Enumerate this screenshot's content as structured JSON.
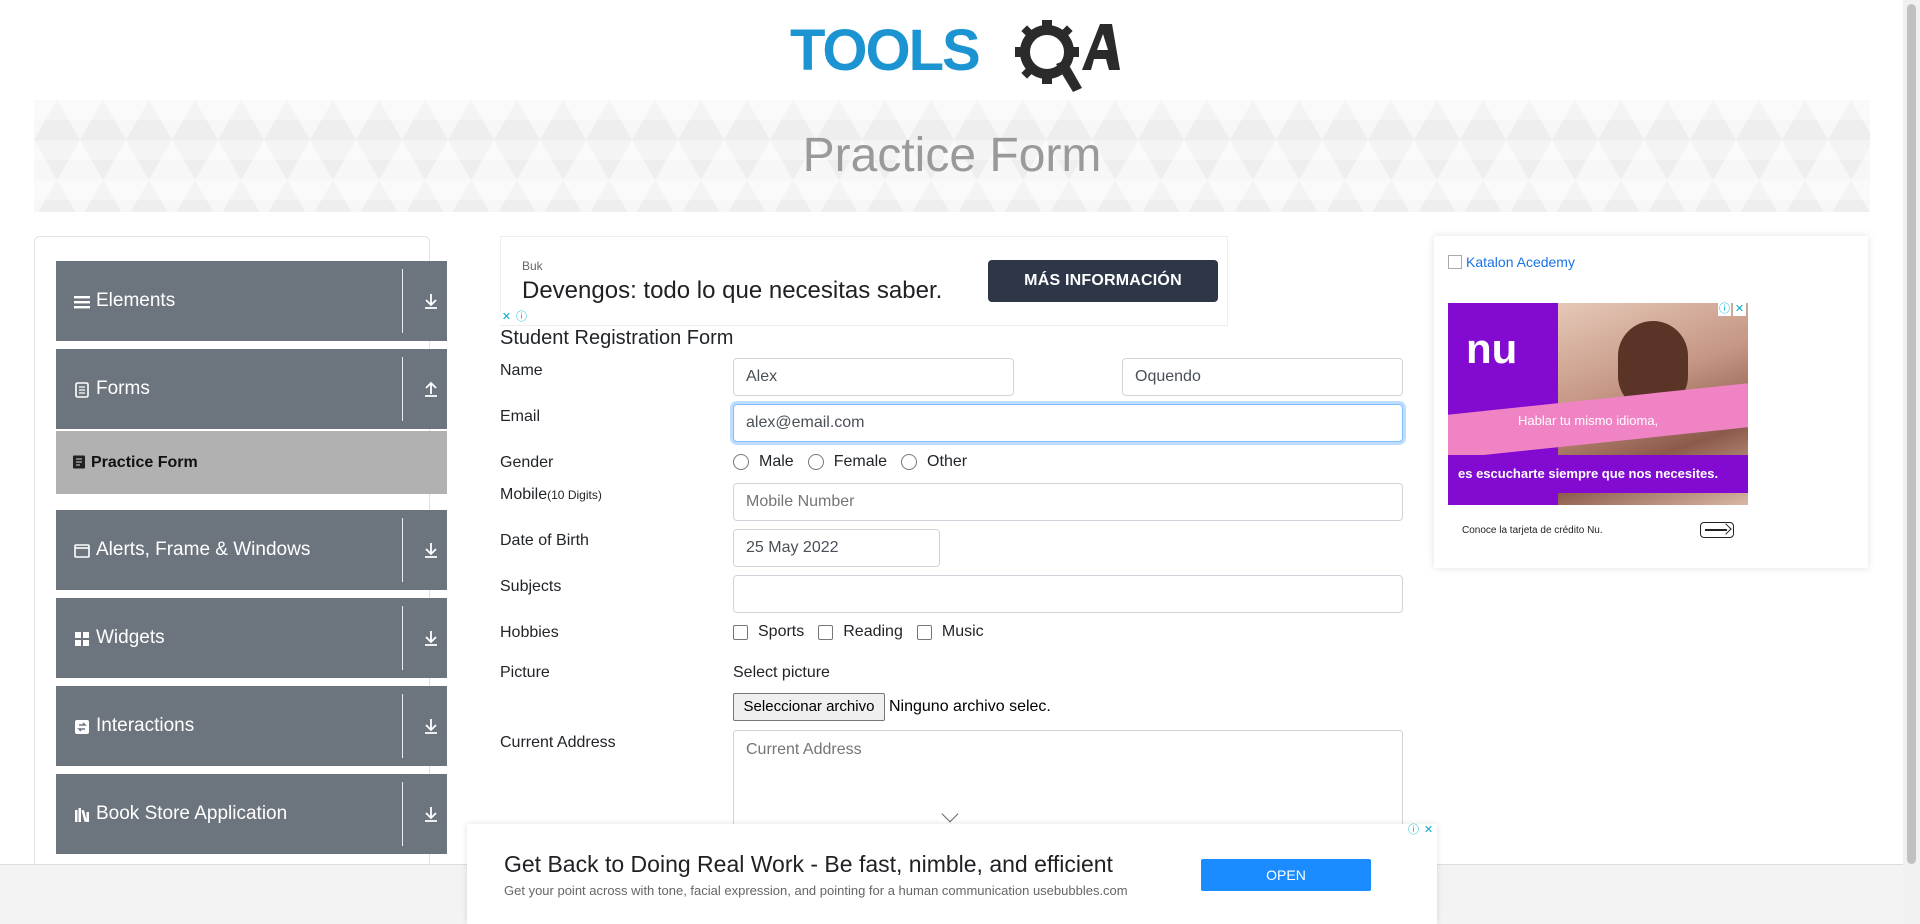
{
  "header": {
    "logo_text": "TOOLSQA",
    "page_title": "Practice Form"
  },
  "sidebar": {
    "groups": [
      {
        "label": "Elements",
        "icon": "hamburger-icon",
        "expanded": false
      },
      {
        "label": "Forms",
        "icon": "document-icon",
        "expanded": true
      },
      {
        "label": "Alerts, Frame & Windows",
        "icon": "window-icon",
        "expanded": false
      },
      {
        "label": "Widgets",
        "icon": "widgets-icon",
        "expanded": false
      },
      {
        "label": "Interactions",
        "icon": "interactions-icon",
        "expanded": false
      },
      {
        "label": "Book Store Application",
        "icon": "books-icon",
        "expanded": false
      }
    ],
    "active_item": {
      "label": "Practice Form",
      "icon": "form-icon"
    }
  },
  "ad_top": {
    "brand": "Buk",
    "headline": "Devengos: todo lo que necesitas saber.",
    "cta": "MÁS INFORMACIÓN"
  },
  "ad_right": {
    "alt_text": "Katalon Acedemy",
    "logo": "nu",
    "line1": "Hablar tu mismo idioma,",
    "line2": "es escucharte siempre que nos necesites.",
    "footer": "Conoce la tarjeta de crédito Nu."
  },
  "form": {
    "title": "Student Registration Form",
    "labels": {
      "name": "Name",
      "email": "Email",
      "gender": "Gender",
      "mobile": "Mobile",
      "mobile_hint": "(10 Digits)",
      "dob": "Date of Birth",
      "subjects": "Subjects",
      "hobbies": "Hobbies",
      "picture": "Picture",
      "address": "Current Address"
    },
    "first_name": "Alex",
    "last_name": "Oquendo",
    "email": "alex@email.com",
    "gender_options": [
      "Male",
      "Female",
      "Other"
    ],
    "mobile_placeholder": "Mobile Number",
    "dob": "25 May 2022",
    "subjects": "",
    "hobby_options": [
      "Sports",
      "Reading",
      "Music"
    ],
    "picture_label": "Select picture",
    "file_button": "Seleccionar archivo",
    "file_status": "Ninguno archivo selec.",
    "address_placeholder": "Current Address"
  },
  "ad_bottom": {
    "headline": "Get Back to Doing Real Work - Be fast, nimble, and efficient",
    "sub": "Get your point across with tone, facial expression, and pointing for a human communication usebubbles.com",
    "cta": "OPEN"
  },
  "colors": {
    "sidebar_group": "#6c757d",
    "active_item": "#b1b1b1",
    "logo_blue": "#1c94d2",
    "logo_dark": "#2b2b2b",
    "nu_purple": "#820ad1"
  }
}
